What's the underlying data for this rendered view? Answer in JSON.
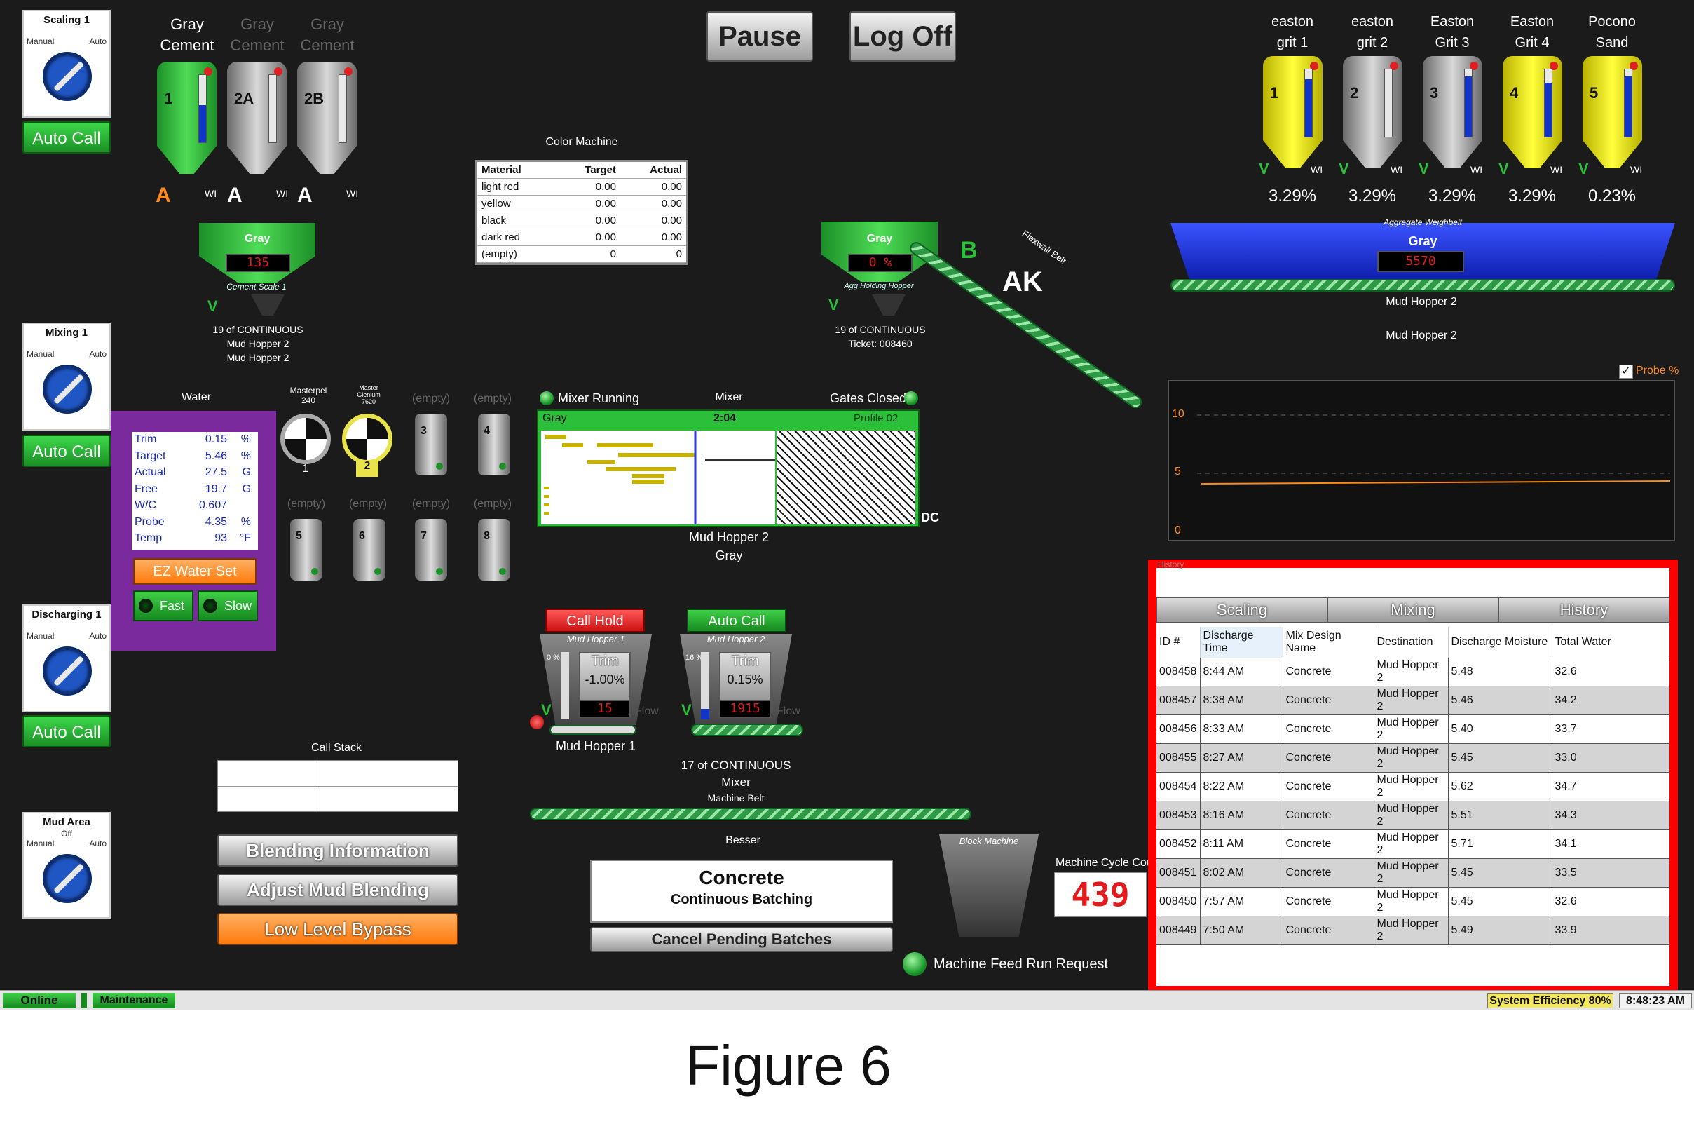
{
  "topbar": {
    "pause_label": "Pause",
    "logoff_label": "Log Off"
  },
  "modes": [
    {
      "title": "Scaling 1",
      "sub": "",
      "manual": "Manual",
      "auto": "Auto",
      "button": "Auto Call"
    },
    {
      "title": "Mixing 1",
      "sub": "",
      "manual": "Manual",
      "auto": "Auto",
      "button": "Auto Call"
    },
    {
      "title": "Discharging 1",
      "sub": "",
      "manual": "Manual",
      "auto": "Auto",
      "button": "Auto Call"
    },
    {
      "title": "Mud Area",
      "sub": "Off",
      "manual": "Manual",
      "auto": "Auto"
    }
  ],
  "cement": {
    "labels": [
      "Gray\nCement",
      "Gray\nCement",
      "Gray\nCement"
    ],
    "silos": [
      {
        "num": "1",
        "badge": "A",
        "wi": "WI",
        "level": 0.55
      },
      {
        "num": "2A",
        "badge": "A",
        "wi": "WI",
        "level": 0
      },
      {
        "num": "2B",
        "badge": "A",
        "wi": "WI",
        "level": 0
      }
    ],
    "scale_name": "Gray",
    "scale_value": "135",
    "scale_caption": "Cement Scale 1",
    "scale_v": "V",
    "status1": "19 of CONTINUOUS",
    "status2": "Mud Hopper 2",
    "status3": "Mud Hopper 2"
  },
  "color_machine": {
    "title": "Color Machine",
    "headers": [
      "Material",
      "Target",
      "Actual"
    ],
    "rows": [
      [
        "light red",
        "0.00",
        "0.00"
      ],
      [
        "yellow",
        "0.00",
        "0.00"
      ],
      [
        "black",
        "0.00",
        "0.00"
      ],
      [
        "dark red",
        "0.00",
        "0.00"
      ],
      [
        "(empty)",
        "0",
        "0"
      ]
    ]
  },
  "agg_scale": {
    "name": "Gray",
    "value": "0 %",
    "caption": "Agg Holding Hopper",
    "v": "V",
    "b": "B",
    "ak": "AK",
    "status1": "19 of CONTINUOUS",
    "status2": "Ticket: 008460",
    "belt_label": "Flexwall Belt"
  },
  "aggregates": {
    "bins": [
      {
        "label": "easton\ngrit 1",
        "num": "1",
        "pct": "3.29%",
        "color": "yellow",
        "level": 0.85,
        "v": "V",
        "wi": "WI"
      },
      {
        "label": "easton\ngrit 2",
        "num": "2",
        "pct": "3.29%",
        "color": "gray",
        "level": 0.0,
        "v": "V",
        "wi": "WI"
      },
      {
        "label": "Easton\nGrit 3",
        "num": "3",
        "pct": "3.29%",
        "color": "gray",
        "level": 0.9,
        "v": "V",
        "wi": "WI"
      },
      {
        "label": "Easton\nGrit 4",
        "num": "4",
        "pct": "3.29%",
        "color": "yellow",
        "level": 0.8,
        "v": "V",
        "wi": "WI"
      },
      {
        "label": "Pocono\nSand",
        "num": "5",
        "pct": "0.23%",
        "color": "yellow",
        "level": 0.9,
        "v": "V",
        "wi": "WI"
      }
    ],
    "weighbelt_caption": "Aggregate Weighbelt",
    "weighbelt_name": "Gray",
    "weighbelt_value": "5570",
    "dest1": "Mud Hopper 2",
    "dest2": "Mud Hopper 2"
  },
  "probe_chart": {
    "checkbox_label": "Probe %",
    "checked": true,
    "y_ticks": [
      "10",
      "5",
      "0"
    ],
    "ylim": [
      0,
      10
    ]
  },
  "water": {
    "title": "Water",
    "rows": [
      [
        "Trim",
        "0.15",
        "%"
      ],
      [
        "Target",
        "5.46",
        "%"
      ],
      [
        "Actual",
        "27.5",
        "G"
      ],
      [
        "Free",
        "19.7",
        "G"
      ],
      [
        "W/C",
        "0.607",
        ""
      ],
      [
        "Probe",
        "4.35",
        "%"
      ],
      [
        "Temp",
        "93",
        "°F"
      ]
    ],
    "ez_label": "EZ Water Set",
    "fast_label": "Fast",
    "slow_label": "Slow"
  },
  "admix": {
    "pumps": [
      {
        "name": "Masterpel\n240",
        "num": "1"
      },
      {
        "name": "Master\nGlenium\n7620",
        "num": "2"
      }
    ],
    "bins_top": [
      {
        "label": "(empty)",
        "num": "3"
      },
      {
        "label": "(empty)",
        "num": "4"
      }
    ],
    "bins_bottom": [
      {
        "label": "(empty)",
        "num": "5"
      },
      {
        "label": "(empty)",
        "num": "6"
      },
      {
        "label": "(empty)",
        "num": "7"
      },
      {
        "label": "(empty)",
        "num": "8"
      }
    ]
  },
  "mixer": {
    "running_label": "Mixer Running",
    "title": "Mixer",
    "gates_label": "Gates Closed",
    "mix_name": "Gray",
    "time": "2:04",
    "profile": "Profile 02",
    "dc": "DC",
    "below1": "Mud Hopper 2",
    "below2": "Gray"
  },
  "hoppers": [
    {
      "button": "Call Hold",
      "name": "Mud Hopper 1",
      "pct": "0 %",
      "trim_label": "Trim",
      "trim": "-1.00%",
      "value": "15",
      "v": "V",
      "flow": "Flow",
      "level": 0.0,
      "caption": "Mud Hopper 1"
    },
    {
      "button": "Auto Call",
      "name": "Mud Hopper 2",
      "pct": "16 %",
      "trim_label": "Trim",
      "trim": "0.15%",
      "value": "1915",
      "v": "V",
      "flow": "Flow",
      "level": 0.16,
      "caption": ""
    }
  ],
  "hopper_status": {
    "line1": "17 of CONTINUOUS",
    "line2": "Mixer",
    "line3": "Machine Belt"
  },
  "call_stack": {
    "title": "Call Stack"
  },
  "actions": {
    "blending": "Blending Information",
    "adjust": "Adjust Mud Blending",
    "bypass": "Low Level Bypass"
  },
  "besser": {
    "title": "Besser",
    "line1": "Concrete",
    "line2": "Continuous Batching",
    "cancel": "Cancel Pending Batches",
    "block_machine": "Block Machine",
    "cycle_label": "Machine Cycle Cou",
    "cycle_value": "439",
    "feed_label": "Machine Feed Run Request"
  },
  "history": {
    "title": "History",
    "tabs": [
      "Scaling",
      "Mixing",
      "History"
    ],
    "headers": [
      "ID #",
      "Discharge Time",
      "Mix Design Name",
      "Destination",
      "Discharge Moisture",
      "Total Water"
    ],
    "rows": [
      [
        "008458",
        "8:44 AM",
        "Concrete",
        "Mud Hopper 2",
        "5.48",
        "32.6"
      ],
      [
        "008457",
        "8:38 AM",
        "Concrete",
        "Mud Hopper 2",
        "5.46",
        "34.2"
      ],
      [
        "008456",
        "8:33 AM",
        "Concrete",
        "Mud Hopper 2",
        "5.40",
        "33.7"
      ],
      [
        "008455",
        "8:27 AM",
        "Concrete",
        "Mud Hopper 2",
        "5.45",
        "33.0"
      ],
      [
        "008454",
        "8:22 AM",
        "Concrete",
        "Mud Hopper 2",
        "5.62",
        "34.7"
      ],
      [
        "008453",
        "8:16 AM",
        "Concrete",
        "Mud Hopper 2",
        "5.51",
        "34.3"
      ],
      [
        "008452",
        "8:11 AM",
        "Concrete",
        "Mud Hopper 2",
        "5.71",
        "34.1"
      ],
      [
        "008451",
        "8:02 AM",
        "Concrete",
        "Mud Hopper 2",
        "5.45",
        "33.5"
      ],
      [
        "008450",
        "7:57 AM",
        "Concrete",
        "Mud Hopper 2",
        "5.45",
        "32.6"
      ],
      [
        "008449",
        "7:50 AM",
        "Concrete",
        "Mud Hopper 2",
        "5.49",
        "33.9"
      ]
    ]
  },
  "statusbar": {
    "online": "Online",
    "maintenance": "Maintenance",
    "efficiency": "System Efficiency 80%",
    "clock": "8:48:23 AM"
  },
  "caption": "Figure 6",
  "colors": {
    "highlight": "#ff0000",
    "purple": "#7a2a9c",
    "accent_green": "#2bbf3a",
    "accent_orange": "#ff8a1c"
  }
}
